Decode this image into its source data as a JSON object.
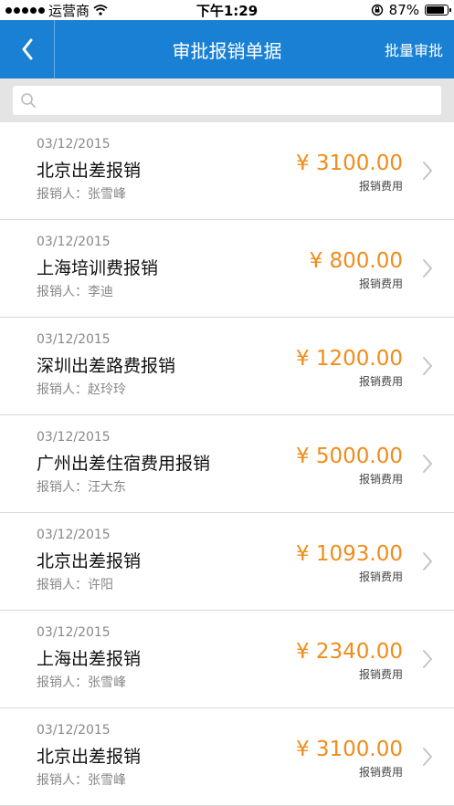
{
  "status": {
    "carrier": "运营商",
    "time": "下午1:29",
    "battery": "87%",
    "battery_level": 0.87
  },
  "nav": {
    "title": "审批报销单据",
    "batch_label": "批量审批"
  },
  "search": {
    "placeholder": "",
    "value": ""
  },
  "colors": {
    "nav": "#1a80d3",
    "amount": "#f08c1a"
  },
  "items": [
    {
      "date": "03/12/2015",
      "title": "北京出差报销",
      "person": "报销人：张雪峰",
      "amount": "¥ 3100.00",
      "kind": "报销费用"
    },
    {
      "date": "03/12/2015",
      "title": "上海培训费报销",
      "person": "报销人：李迪",
      "amount": "¥ 800.00",
      "kind": "报销费用"
    },
    {
      "date": "03/12/2015",
      "title": "深圳出差路费报销",
      "person": "报销人：赵玲玲",
      "amount": "¥ 1200.00",
      "kind": "报销费用"
    },
    {
      "date": "03/12/2015",
      "title": "广州出差住宿费用报销",
      "person": "报销人：汪大东",
      "amount": "¥ 5000.00",
      "kind": "报销费用"
    },
    {
      "date": "03/12/2015",
      "title": "北京出差报销",
      "person": "报销人：许阳",
      "amount": "¥ 1093.00",
      "kind": "报销费用"
    },
    {
      "date": "03/12/2015",
      "title": "上海出差报销",
      "person": "报销人：张雪峰",
      "amount": "¥ 2340.00",
      "kind": "报销费用"
    },
    {
      "date": "03/12/2015",
      "title": "北京出差报销",
      "person": "报销人：张雪峰",
      "amount": "¥ 3100.00",
      "kind": "报销费用"
    }
  ]
}
